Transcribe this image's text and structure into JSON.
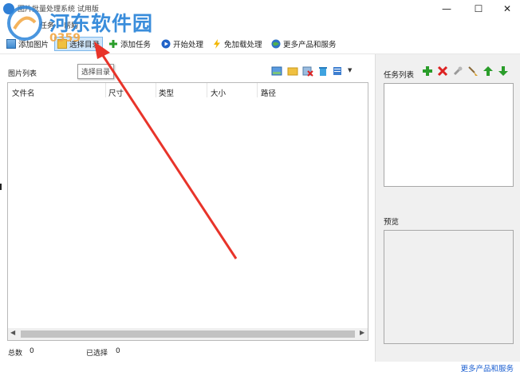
{
  "window": {
    "title": "图片批量处理系统 试用版",
    "controls": {
      "minimize": "—",
      "maximize": "☐",
      "close": "✕"
    }
  },
  "watermark": {
    "site_name": "河东软件园",
    "url_fragment": "0359"
  },
  "menu": {
    "items": [
      "任务",
      "帮助"
    ]
  },
  "toolbar": {
    "add_images": "添加图片",
    "select_dir": "选择目录",
    "add_task": "添加任务",
    "start": "开始处理",
    "accelerate": "免加载处理",
    "more": "更多产品和服务"
  },
  "image_list": {
    "label": "图片列表",
    "tooltip": "选择目录",
    "columns": [
      "文件名",
      "尺寸",
      "类型",
      "大小",
      "路径"
    ],
    "rows": []
  },
  "status": {
    "total_label": "总数",
    "total_value": "0",
    "selected_label": "已选择",
    "selected_value": "0"
  },
  "tasks": {
    "label": "任务列表"
  },
  "preview": {
    "label": "预览"
  },
  "footer": {
    "more_link": "更多产品和服务"
  },
  "colors": {
    "accent_blue": "#2a84d9",
    "selected_bg": "#cfe6fb",
    "arrow_red": "#e8342a",
    "panel_gray": "#f0f0f0"
  }
}
